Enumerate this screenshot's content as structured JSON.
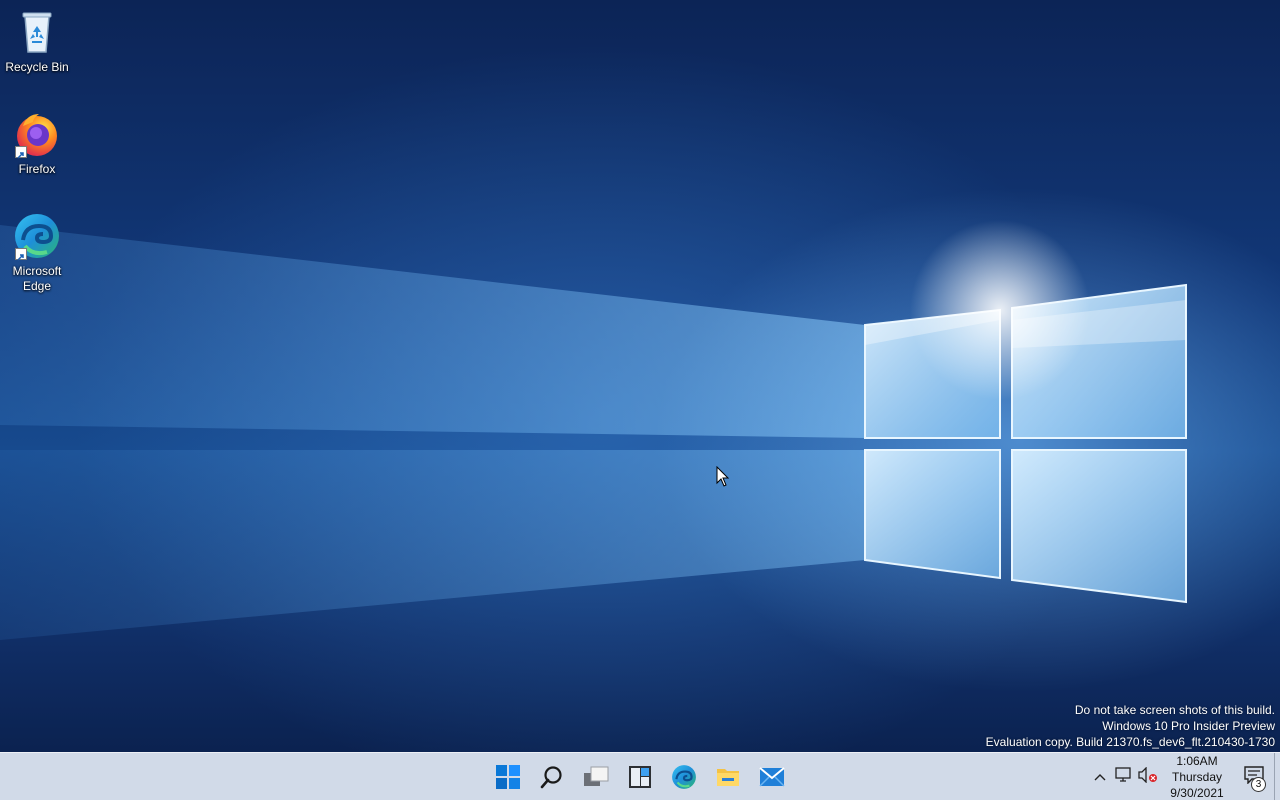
{
  "desktop": {
    "icons": [
      {
        "label": "Recycle Bin",
        "icon": "recycle-bin-icon"
      },
      {
        "label": "Firefox",
        "icon": "firefox-icon"
      },
      {
        "label": "Microsoft Edge",
        "icon": "edge-icon"
      }
    ]
  },
  "watermark": {
    "line1": "Do not take screen shots of this build.",
    "line2": "Windows 10 Pro Insider Preview",
    "line3": "Evaluation copy. Build 21370.fs_dev6_flt.210430-1730"
  },
  "taskbar": {
    "pinned": [
      {
        "name": "start",
        "icon": "windows-start-icon"
      },
      {
        "name": "search",
        "icon": "search-icon"
      },
      {
        "name": "task-view",
        "icon": "task-view-icon"
      },
      {
        "name": "widgets",
        "icon": "widgets-icon"
      },
      {
        "name": "edge",
        "icon": "edge-icon"
      },
      {
        "name": "file-explorer",
        "icon": "folder-icon"
      },
      {
        "name": "mail",
        "icon": "mail-icon"
      }
    ],
    "tray": {
      "icons": [
        "chevron-up-icon",
        "network-icon",
        "volume-muted-icon"
      ],
      "time": "1:06AM",
      "day": "Thursday",
      "date": "9/30/2021",
      "notification_count": "3"
    }
  },
  "colors": {
    "accent": "#0078d4",
    "taskbar_bg": "#dae2ee"
  }
}
